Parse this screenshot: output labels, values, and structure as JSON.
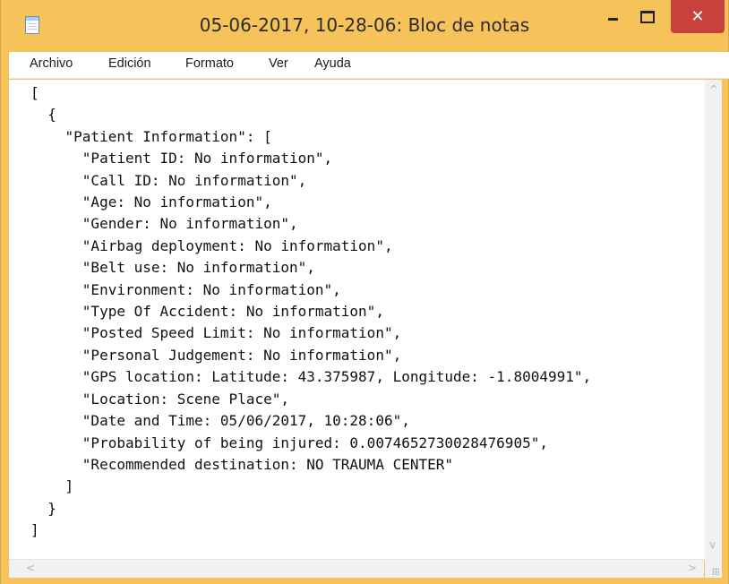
{
  "window": {
    "title": "05-06-2017, 10-28-06: Bloc de notas",
    "close_symbol": "✕"
  },
  "menu": [
    "Archivo",
    "Edición",
    "Formato",
    "Ver",
    "Ayuda"
  ],
  "document": {
    "lines": [
      "[",
      "  {",
      "    \"Patient Information\": [",
      "      \"Patient ID: No information\",",
      "      \"Call ID: No information\",",
      "      \"Age: No information\",",
      "      \"Gender: No information\",",
      "      \"Airbag deployment: No information\",",
      "      \"Belt use: No information\",",
      "      \"Environment: No information\",",
      "      \"Type Of Accident: No information\",",
      "      \"Posted Speed Limit: No information\",",
      "      \"Personal Judgement: No information\",",
      "      \"GPS location: Latitude: 43.375987, Longitude: -1.8004991\",",
      "      \"Location: Scene Place\",",
      "      \"Date and Time: 05/06/2017, 10:28:06\",",
      "      \"Probability of being injured: 0.0074652730028476905\",",
      "      \"Recommended destination: NO TRAUMA CENTER\"",
      "    ]",
      "  }",
      "]"
    ]
  },
  "scroll": {
    "up": "^",
    "down": "v",
    "left": "<",
    "right": ">"
  },
  "colors": {
    "frame": "#f6c25a",
    "close": "#c8413a",
    "text": "#111111"
  }
}
